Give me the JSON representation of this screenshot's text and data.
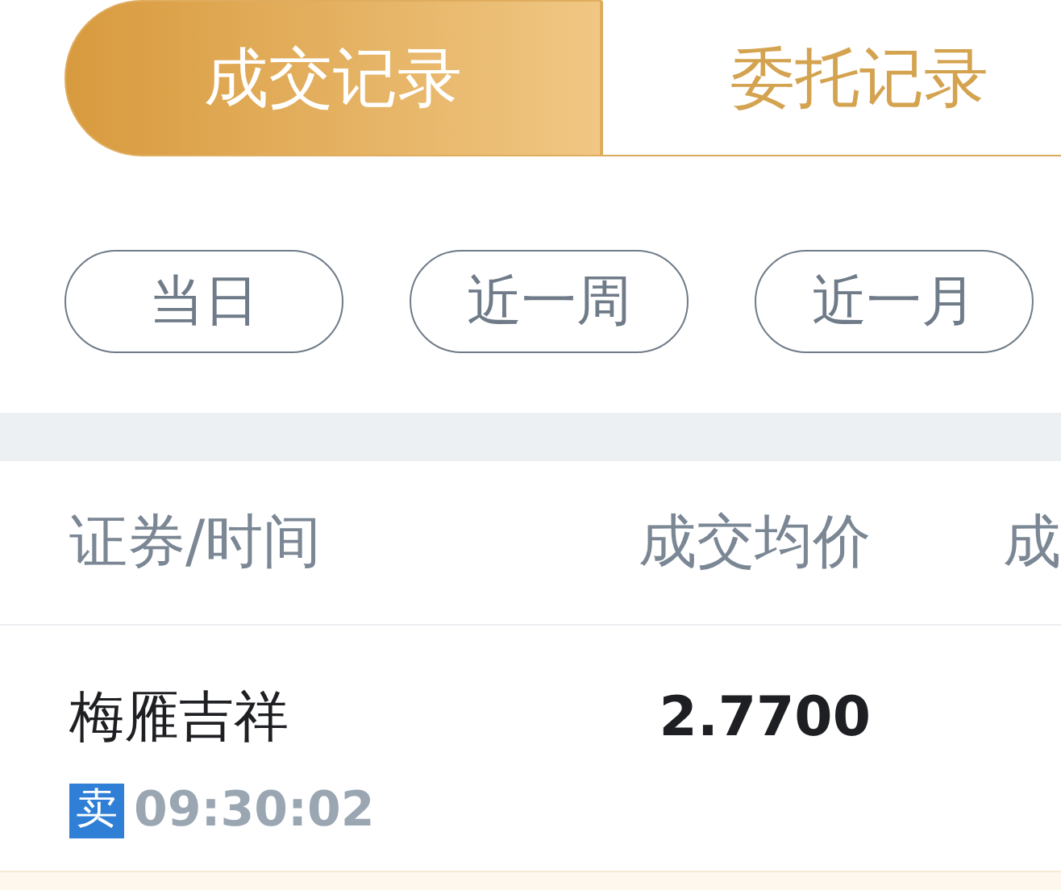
{
  "tabs": [
    {
      "label": "成交记录",
      "selected": true
    },
    {
      "label": "委托记录",
      "selected": false
    }
  ],
  "period_filters": [
    {
      "label": "当日",
      "selected": false
    },
    {
      "label": "近一周",
      "selected": false
    },
    {
      "label": "近一月",
      "selected": false
    }
  ],
  "table": {
    "columns": [
      "证券/时间",
      "成交均价",
      "成"
    ],
    "rows": [
      {
        "name": "梅雁吉祥",
        "side": "卖",
        "time": "09:30:02",
        "avg_price": "2.7700"
      }
    ]
  }
}
